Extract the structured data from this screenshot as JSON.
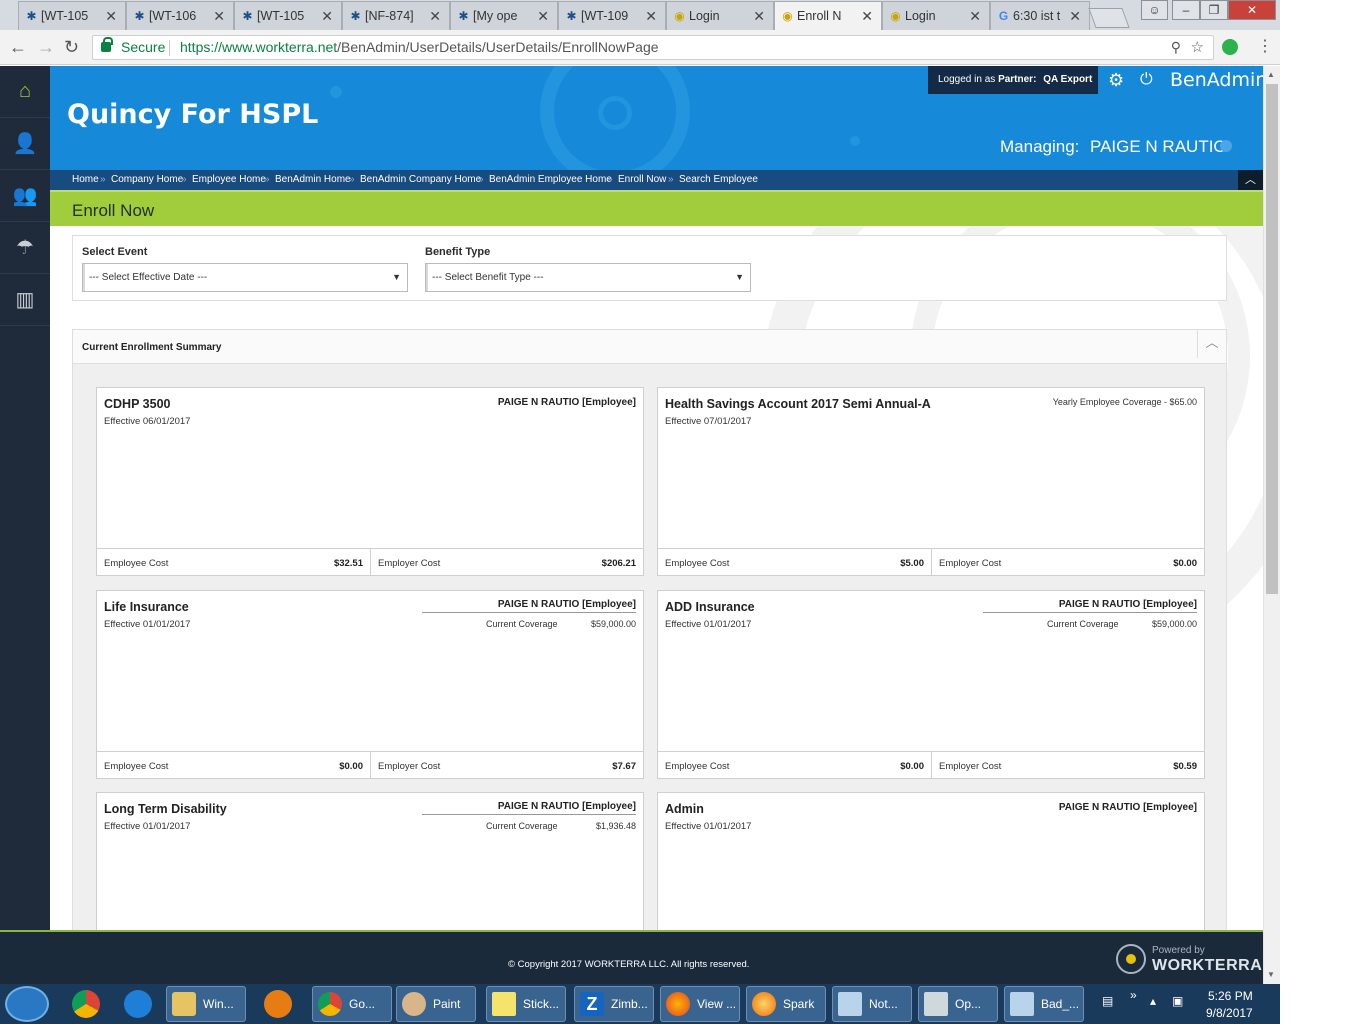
{
  "browser": {
    "tabs": [
      {
        "label": "[WT-105",
        "icon": "jira-icon"
      },
      {
        "label": "[WT-106",
        "icon": "jira-icon"
      },
      {
        "label": "[WT-105",
        "icon": "jira-icon"
      },
      {
        "label": "[NF-874]",
        "icon": "jira-icon"
      },
      {
        "label": "[My ope",
        "icon": "jira-icon"
      },
      {
        "label": "[WT-109",
        "icon": "jira-icon"
      },
      {
        "label": "Login",
        "icon": "workterra-icon"
      },
      {
        "label": "Enroll N",
        "icon": "workterra-icon"
      },
      {
        "label": "Login",
        "icon": "workterra-icon"
      },
      {
        "label": "6:30 ist t",
        "icon": "google-icon"
      }
    ],
    "active_tab_index": 7,
    "secure_label": "Secure",
    "url_host": "https://www.workterra.net",
    "url_path": "/BenAdmin/UserDetails/UserDetails/EnrollNowPage"
  },
  "header": {
    "company": "Quincy For HSPL",
    "logged_in_prefix": "Logged in as",
    "logged_in_role": "Partner:",
    "logged_in_name": "QA Export",
    "brand": "BenAdmin",
    "managing_label": "Managing:",
    "managing_name": "PAIGE N RAUTIO",
    "accent_color": "#1689d8",
    "dark_color": "#1f2b3a"
  },
  "breadcrumbs": [
    "Home",
    "Company Home",
    "Employee Home",
    "BenAdmin Home",
    "BenAdmin Company Home",
    "BenAdmin Employee Home",
    "Enroll Now",
    "Search Employee"
  ],
  "page_title": "Enroll Now",
  "sidebar": {
    "items": [
      {
        "icon": "home-icon"
      },
      {
        "icon": "user-icon"
      },
      {
        "icon": "users-icon"
      },
      {
        "icon": "benefits-icon"
      },
      {
        "icon": "reports-icon"
      }
    ]
  },
  "filters": {
    "event_label": "Select Event",
    "event_value": "--- Select Effective Date ---",
    "benefit_label": "Benefit Type",
    "benefit_value": "--- Select Benefit Type ---"
  },
  "summary": {
    "title": "Current Enrollment Summary",
    "cards": [
      {
        "name": "CDHP 3500",
        "effective": "Effective 06/01/2017",
        "employee": "PAIGE N RAUTIO [Employee]",
        "employee_cost_label": "Employee Cost",
        "employee_cost": "$32.51",
        "employer_cost_label": "Employer Cost",
        "employer_cost": "$206.21"
      },
      {
        "name": "Health Savings Account 2017 Semi Annual-A",
        "effective": "Effective 07/01/2017",
        "yearly": "Yearly Employee Coverage - $65.00",
        "employee_cost_label": "Employee Cost",
        "employee_cost": "$5.00",
        "employer_cost_label": "Employer Cost",
        "employer_cost": "$0.00"
      },
      {
        "name": "Life Insurance",
        "effective": "Effective 01/01/2017",
        "employee": "PAIGE N RAUTIO [Employee]",
        "coverage_label": "Current Coverage",
        "coverage_value": "$59,000.00",
        "employee_cost_label": "Employee Cost",
        "employee_cost": "$0.00",
        "employer_cost_label": "Employer Cost",
        "employer_cost": "$7.67"
      },
      {
        "name": "ADD Insurance",
        "effective": "Effective 01/01/2017",
        "employee": "PAIGE N RAUTIO [Employee]",
        "coverage_label": "Current Coverage",
        "coverage_value": "$59,000.00",
        "employee_cost_label": "Employee Cost",
        "employee_cost": "$0.00",
        "employer_cost_label": "Employer Cost",
        "employer_cost": "$0.59"
      },
      {
        "name": "Long Term Disability",
        "effective": "Effective 01/01/2017",
        "employee": "PAIGE N RAUTIO [Employee]",
        "coverage_label": "Current Coverage",
        "coverage_value": "$1,936.48"
      },
      {
        "name": "Admin",
        "effective": "Effective 01/01/2017",
        "employee": "PAIGE N RAUTIO [Employee]"
      }
    ]
  },
  "footer": {
    "copyright": "© Copyright 2017 WORKTERRA LLC. All rights reserved.",
    "powered_by": "Powered by",
    "powered_brand": "WORKTERRA"
  },
  "taskbar": {
    "buttons": [
      {
        "label": "Win...",
        "icon": "explorer-icon"
      },
      {
        "label": "Go...",
        "icon": "chrome-icon"
      },
      {
        "label": "Paint",
        "icon": "paint-icon"
      },
      {
        "label": "Stick...",
        "icon": "sticky-notes-icon"
      },
      {
        "label": "Zimb...",
        "icon": "zimbra-icon"
      },
      {
        "label": "View ...",
        "icon": "firefox-icon"
      },
      {
        "label": "Spark",
        "icon": "spark-icon"
      },
      {
        "label": "Not...",
        "icon": "notepad-icon"
      },
      {
        "label": "Op...",
        "icon": "calculator-icon"
      },
      {
        "label": "Bad_...",
        "icon": "notepad-icon"
      }
    ],
    "time": "5:26 PM",
    "date": "9/8/2017"
  }
}
